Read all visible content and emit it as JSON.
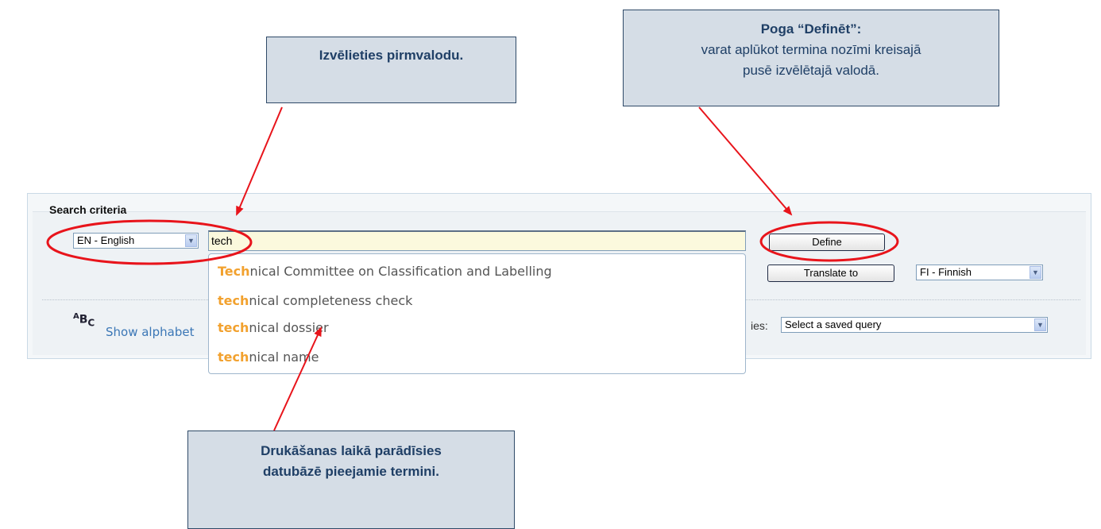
{
  "callouts": {
    "language": "Izvēlieties pirmvalodu.",
    "define_title": "Poga “Definēt”:",
    "define_line1": "varat aplūkot termina nozīmi kreisajā",
    "define_line2": "pusē izvēlētajā valodā.",
    "typing_line1": "Drukāšanas laikā parādīsies",
    "typing_line2": "datubāzē pieejamie termini."
  },
  "search": {
    "title": "Search criteria",
    "source_language": "EN - English",
    "query": "tech",
    "define_label": "Define",
    "translate_label": "Translate to",
    "target_language": "FI - Finnish",
    "alphabetic_link": "Show alphabet",
    "saved_queries_label": "ies:",
    "saved_query_value": "Select a saved query"
  },
  "suggestions": [
    {
      "highlight": "Tech",
      "rest": "nical Committee on Classification and Labelling"
    },
    {
      "highlight": "tech",
      "rest": "nical completeness check"
    },
    {
      "highlight": "tech",
      "rest": "nical dossier"
    },
    {
      "highlight": "tech",
      "rest": "nical name"
    }
  ],
  "icons": {
    "abc": "ABC",
    "dropdown_arrow": "chevron-down-icon"
  },
  "colors": {
    "callout_bg": "#d5dde6",
    "callout_text": "#1f3f66",
    "highlight": "#f2a12e",
    "annotation": "#e8141b",
    "link": "#3b77b6",
    "input_bg": "#fbf9dd"
  }
}
